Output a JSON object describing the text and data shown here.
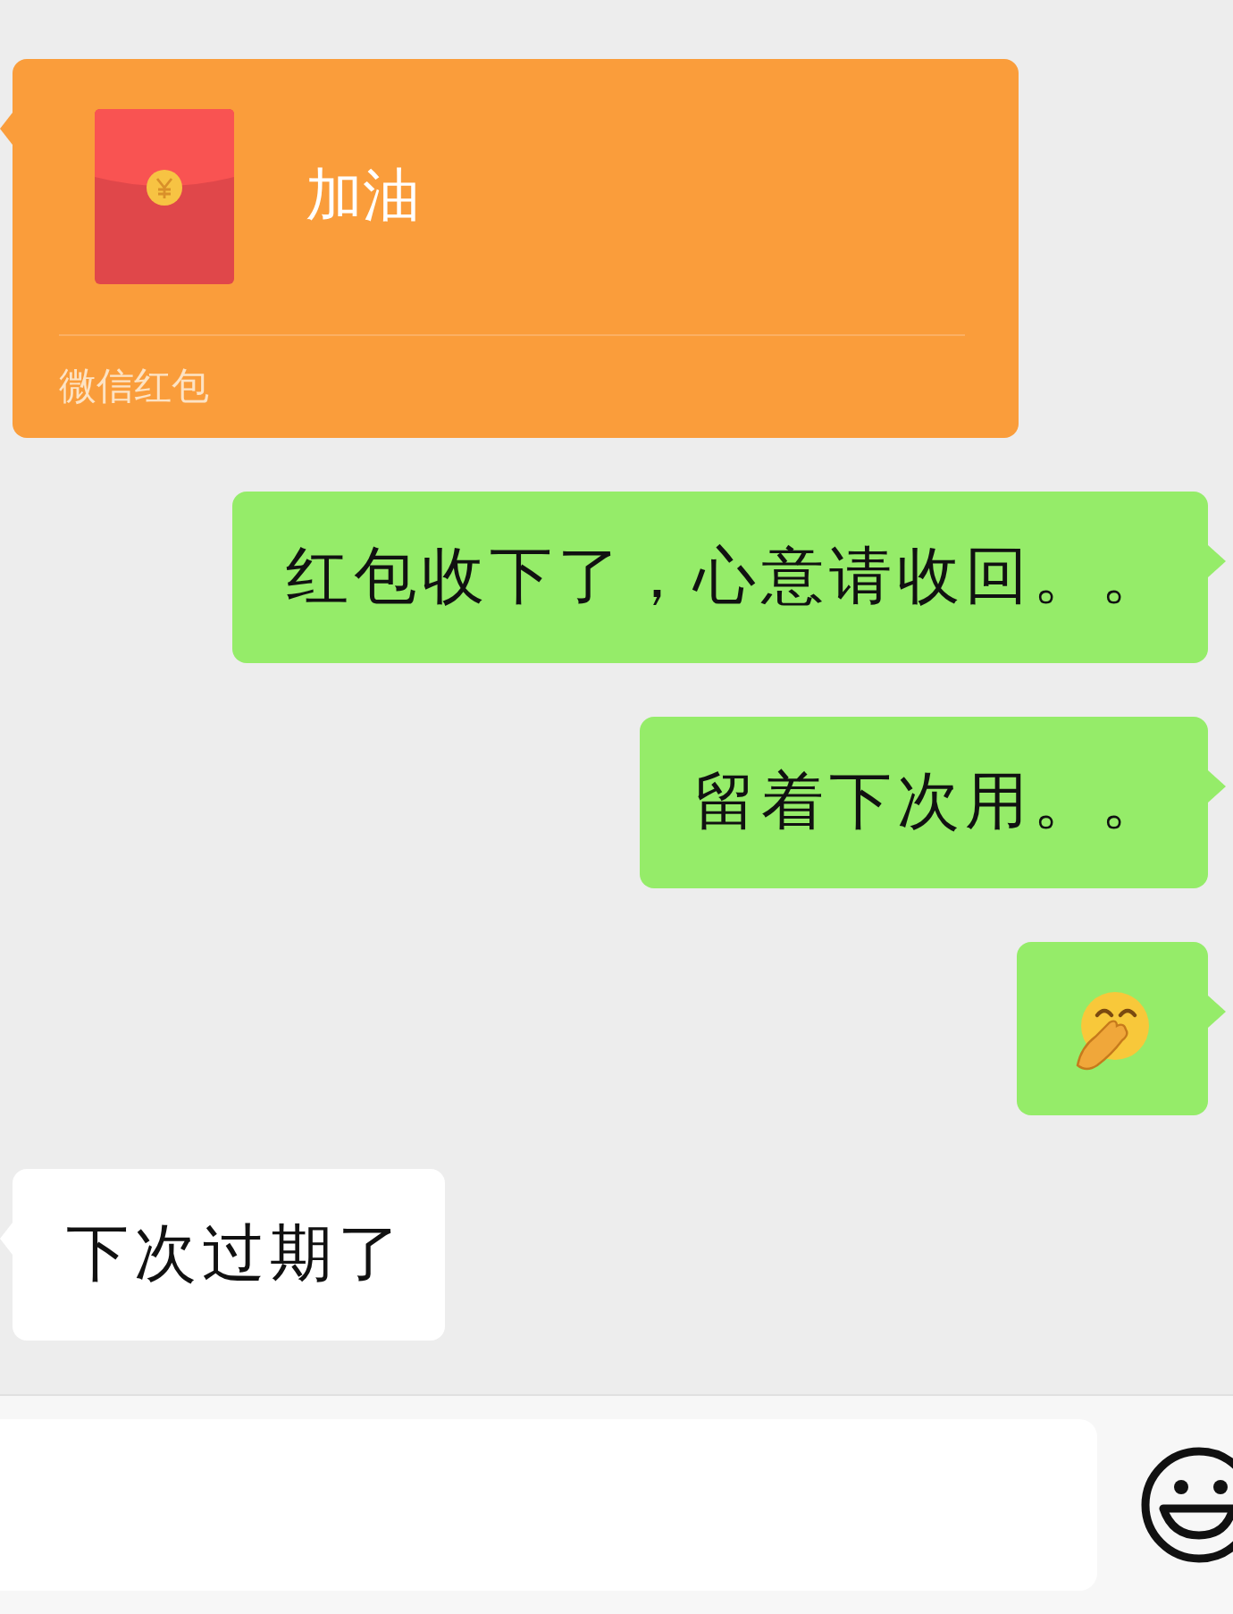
{
  "messages": [
    {
      "kind": "red_packet",
      "outgoing": false,
      "title": "加油",
      "caption": "微信红包"
    },
    {
      "kind": "text",
      "outgoing": true,
      "text": "红包收下了，心意请收回。。"
    },
    {
      "kind": "text",
      "outgoing": true,
      "text": "留着下次用。。"
    },
    {
      "kind": "emoji",
      "outgoing": true
    },
    {
      "kind": "text",
      "outgoing": false,
      "text": "下次过期了"
    }
  ]
}
